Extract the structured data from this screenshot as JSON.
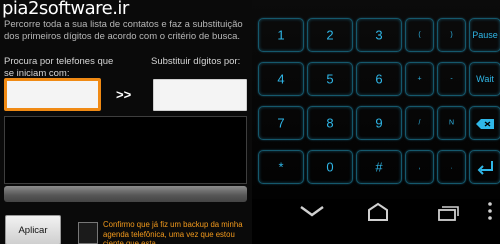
{
  "app": {
    "watermark": "pia2software.ir",
    "description": "Percorre toda a sua lista de contatos e faz a substituição dos primeiros dígitos de acordo com o critério de busca.",
    "search_label": "Procura por telefones que se iniciam com:",
    "replace_label": "Substituir dígitos por:",
    "search_value": "",
    "replace_value": "",
    "arrow_text": ">>",
    "apply_label": "Aplicar",
    "confirm_text": "Confirmo que já fiz um backup da minha agenda telefônica, uma vez que estou ciente que esta",
    "accent_color": "#f08a14"
  },
  "keyboard": {
    "accent_color": "#2fb7e8",
    "row1": [
      "1",
      "2",
      "3",
      "(",
      ")",
      "Pause"
    ],
    "row2": [
      "4",
      "5",
      "6",
      "+",
      "-",
      "Wait"
    ],
    "row3": [
      "7",
      "8",
      "9",
      "/",
      "N",
      "backspace-icon"
    ],
    "row4": [
      "*",
      "0",
      "#",
      ",",
      ".",
      "enter-icon"
    ]
  },
  "navbar": {
    "icons": [
      "back-icon",
      "home-icon",
      "recent-apps-icon",
      "menu-icon"
    ]
  }
}
